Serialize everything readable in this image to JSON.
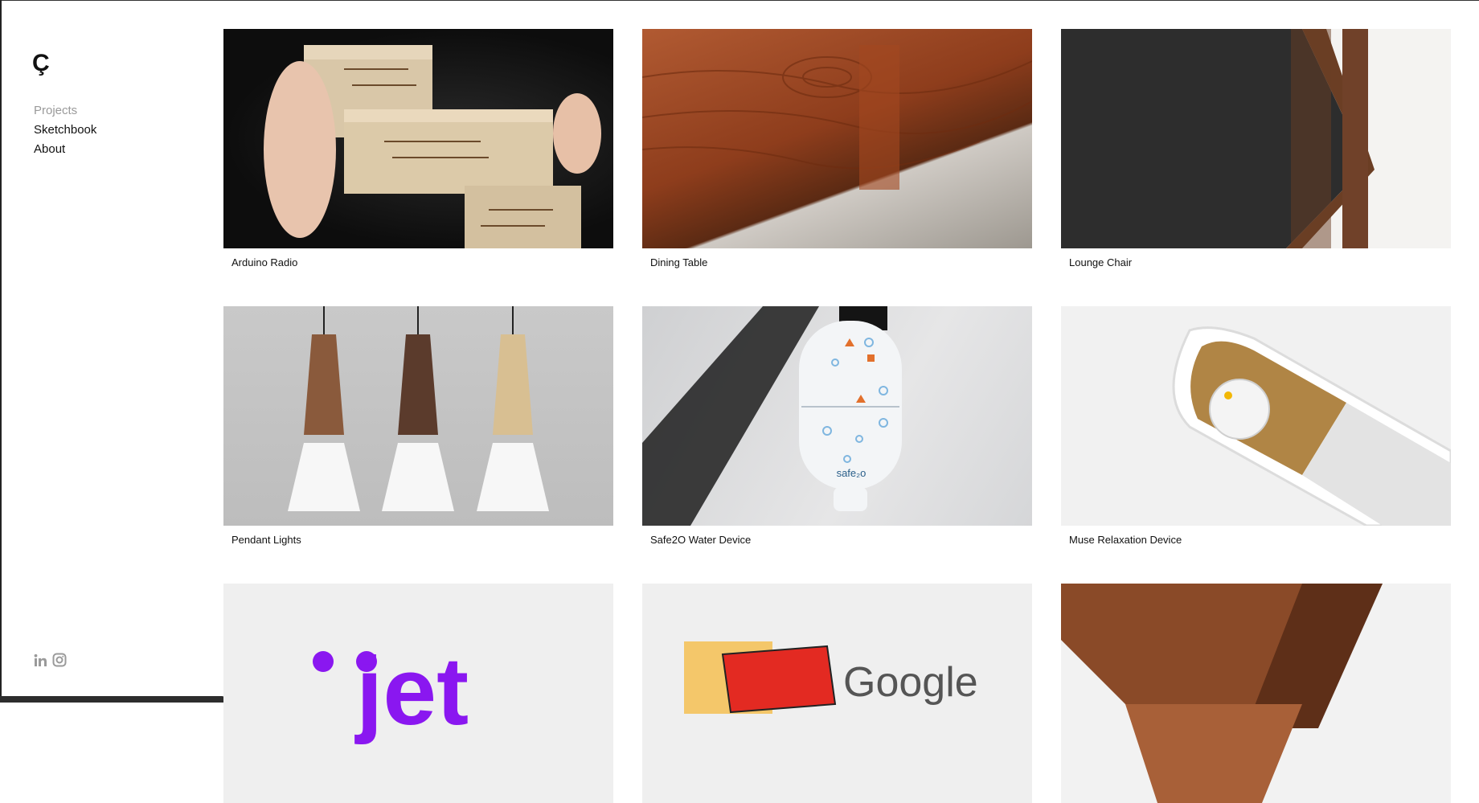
{
  "sidebar": {
    "logo": "Ç",
    "nav": [
      {
        "label": "Projects"
      },
      {
        "label": "Sketchbook"
      },
      {
        "label": "About"
      }
    ],
    "social": [
      {
        "icon": "linkedin-icon"
      },
      {
        "icon": "instagram-icon"
      }
    ]
  },
  "projects": [
    {
      "title": "Arduino Radio"
    },
    {
      "title": "Dining Table"
    },
    {
      "title": "Lounge Chair"
    },
    {
      "title": "Pendant Lights"
    },
    {
      "title": "Safe2O Water Device"
    },
    {
      "title": "Muse Relaxation Device"
    },
    {
      "title": ""
    },
    {
      "title": ""
    },
    {
      "title": ""
    }
  ],
  "artwork_text": {
    "safe_label": "safe₂o",
    "jet_text": "jet",
    "google_text": "Google"
  },
  "colors": {
    "nav_muted": "#9a9a9a",
    "text": "#111111",
    "jet_purple": "#8a17f0"
  }
}
